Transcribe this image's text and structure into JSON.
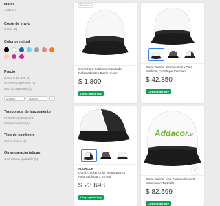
{
  "filters": {
    "brand": {
      "title": "Marca",
      "items": [
        "Addacor"
      ]
    },
    "shipping": {
      "title": "Coste de envío",
      "items": [
        "Gratis (6)"
      ]
    },
    "color": {
      "title": "Color principal",
      "swatches": [
        "#000000",
        "#ffffff",
        "#1f5fa8",
        "#6fd0f0",
        "#9e9e9e",
        "#f08080",
        "#ff7a1a",
        "#ffc7b8",
        "#c0398a",
        "#e0207a"
      ]
    },
    "price": {
      "title": "Precio",
      "items": [
        "Hasta $ 15.000 (1)",
        "$15.000 a $80.000 (3)",
        "Más de $80.000 (3)"
      ],
      "min_placeholder": "Mínimo",
      "max_placeholder": "Máximo",
      "go": ">"
    },
    "season": {
      "title": "Temporada de lanzamiento",
      "items": [
        "Primavera/Verano (4)",
        "Otoño/Invierno (1)"
      ]
    },
    "hat_type": {
      "title": "Tipo de sombrero",
      "items": [
        "Gorra visera (6)"
      ]
    },
    "other": {
      "title": "Otras características",
      "items": [
        "Con correa ajustable (6)"
      ]
    }
  },
  "products": [
    {
      "colors_label": "2 colores",
      "title": "Gorra Para Sublimar Importada Reforzada Con Doble Ajuste",
      "price": "$ 1.800",
      "badge": "Llega gratis hoy"
    },
    {
      "title": "Gorra Trucker Camion Gorra Para Sublimar Por Mayor Premium",
      "price": "$ 42.850",
      "badge": "Llega gratis hoy"
    },
    {
      "brand": "ADDACOR",
      "title": "Gorra Trucker Color Negro Blanco Para Sublimar X 25 Uni",
      "price": "$ 23.698",
      "badge": "Llega gratis hoy"
    },
    {
      "logo_text": "Addacor",
      "logo_suffix": ".ar",
      "title": "Gorra Trucker Lisa Para Sublimar O Estampar A Tu Estilo",
      "price": "$ 82.599",
      "badge": "Llega gratis hoy"
    }
  ]
}
